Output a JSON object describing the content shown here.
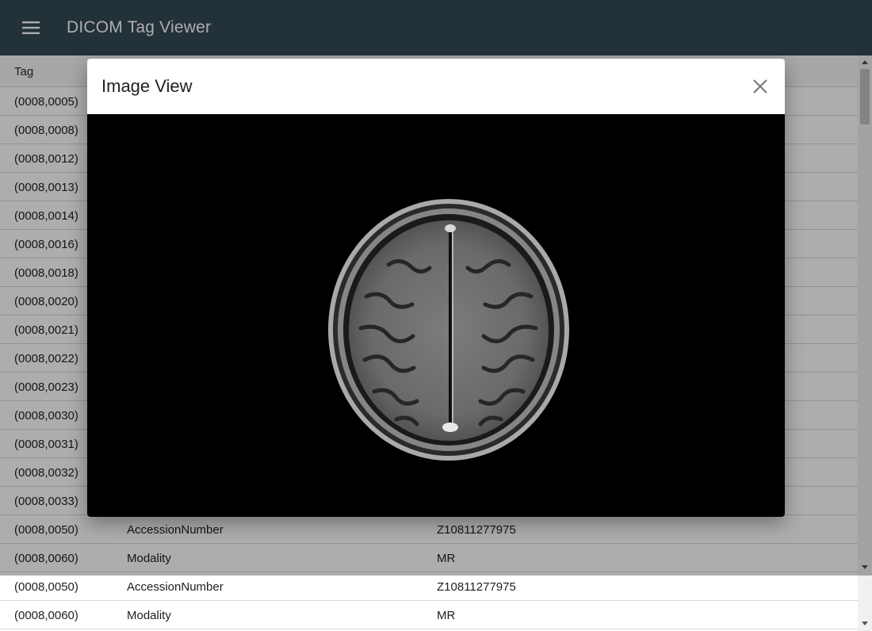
{
  "app": {
    "title": "DICOM Tag Viewer",
    "menu_icon": "menu-icon"
  },
  "table": {
    "header": {
      "tag": "Tag"
    },
    "rows": [
      {
        "tag": "(0008,0005)",
        "name": "",
        "value": ""
      },
      {
        "tag": "(0008,0008)",
        "name": "",
        "value": ""
      },
      {
        "tag": "(0008,0012)",
        "name": "",
        "value": ""
      },
      {
        "tag": "(0008,0013)",
        "name": "",
        "value": ""
      },
      {
        "tag": "(0008,0014)",
        "name": "",
        "value": ""
      },
      {
        "tag": "(0008,0016)",
        "name": "",
        "value": ""
      },
      {
        "tag": "(0008,0018)",
        "name": "",
        "value": ""
      },
      {
        "tag": "(0008,0020)",
        "name": "",
        "value": ""
      },
      {
        "tag": "(0008,0021)",
        "name": "",
        "value": ""
      },
      {
        "tag": "(0008,0022)",
        "name": "",
        "value": ""
      },
      {
        "tag": "(0008,0023)",
        "name": "",
        "value": ""
      },
      {
        "tag": "(0008,0030)",
        "name": "",
        "value": ""
      },
      {
        "tag": "(0008,0031)",
        "name": "",
        "value": ""
      },
      {
        "tag": "(0008,0032)",
        "name": "",
        "value": ""
      },
      {
        "tag": "(0008,0033)",
        "name": "",
        "value": ""
      },
      {
        "tag": "(0008,0050)",
        "name": "AccessionNumber",
        "value": "Z10811277975"
      },
      {
        "tag": "(0008,0060)",
        "name": "Modality",
        "value": "MR"
      },
      {
        "tag": "(0008,0050)",
        "name": "AccessionNumber",
        "value": "Z10811277975"
      },
      {
        "tag": "(0008,0060)",
        "name": "Modality",
        "value": "MR"
      }
    ]
  },
  "dialog": {
    "title": "Image View",
    "close_icon": "close-icon"
  },
  "colors": {
    "appbar": "#344955",
    "image_bg": "#000000"
  }
}
